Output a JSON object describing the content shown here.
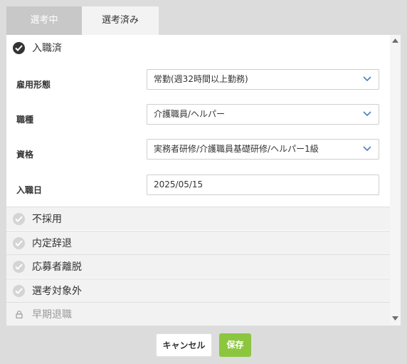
{
  "tabs": [
    {
      "label": "選考中",
      "state": "inactive"
    },
    {
      "label": "選考済み",
      "state": "active"
    }
  ],
  "hired": {
    "label": "入職済",
    "fields": [
      {
        "label": "雇用形態",
        "value": "常勤(週32時間以上勤務)",
        "kind": "select"
      },
      {
        "label": "職種",
        "value": "介護職員/ヘルパー",
        "kind": "select"
      },
      {
        "label": "資格",
        "value": "実務者研修/介護職員基礎研修/ヘルパー1級",
        "kind": "select"
      },
      {
        "label": "入職日",
        "value": "2025/05/15",
        "kind": "text"
      }
    ]
  },
  "statuses": [
    {
      "label": "不採用",
      "icon": "check-circle-icon",
      "locked": false
    },
    {
      "label": "内定辞退",
      "icon": "check-circle-icon",
      "locked": false
    },
    {
      "label": "応募者離脱",
      "icon": "check-circle-icon",
      "locked": false
    },
    {
      "label": "選考対象外",
      "icon": "check-circle-icon",
      "locked": false
    },
    {
      "label": "早期退職",
      "icon": "lock-icon",
      "locked": true
    }
  ],
  "buttons": {
    "cancel": "キャンセル",
    "save": "保存"
  },
  "colors": {
    "save": "#8cc63f",
    "inactive_tab": "#c8c8c8",
    "dark_check": "#333333"
  }
}
